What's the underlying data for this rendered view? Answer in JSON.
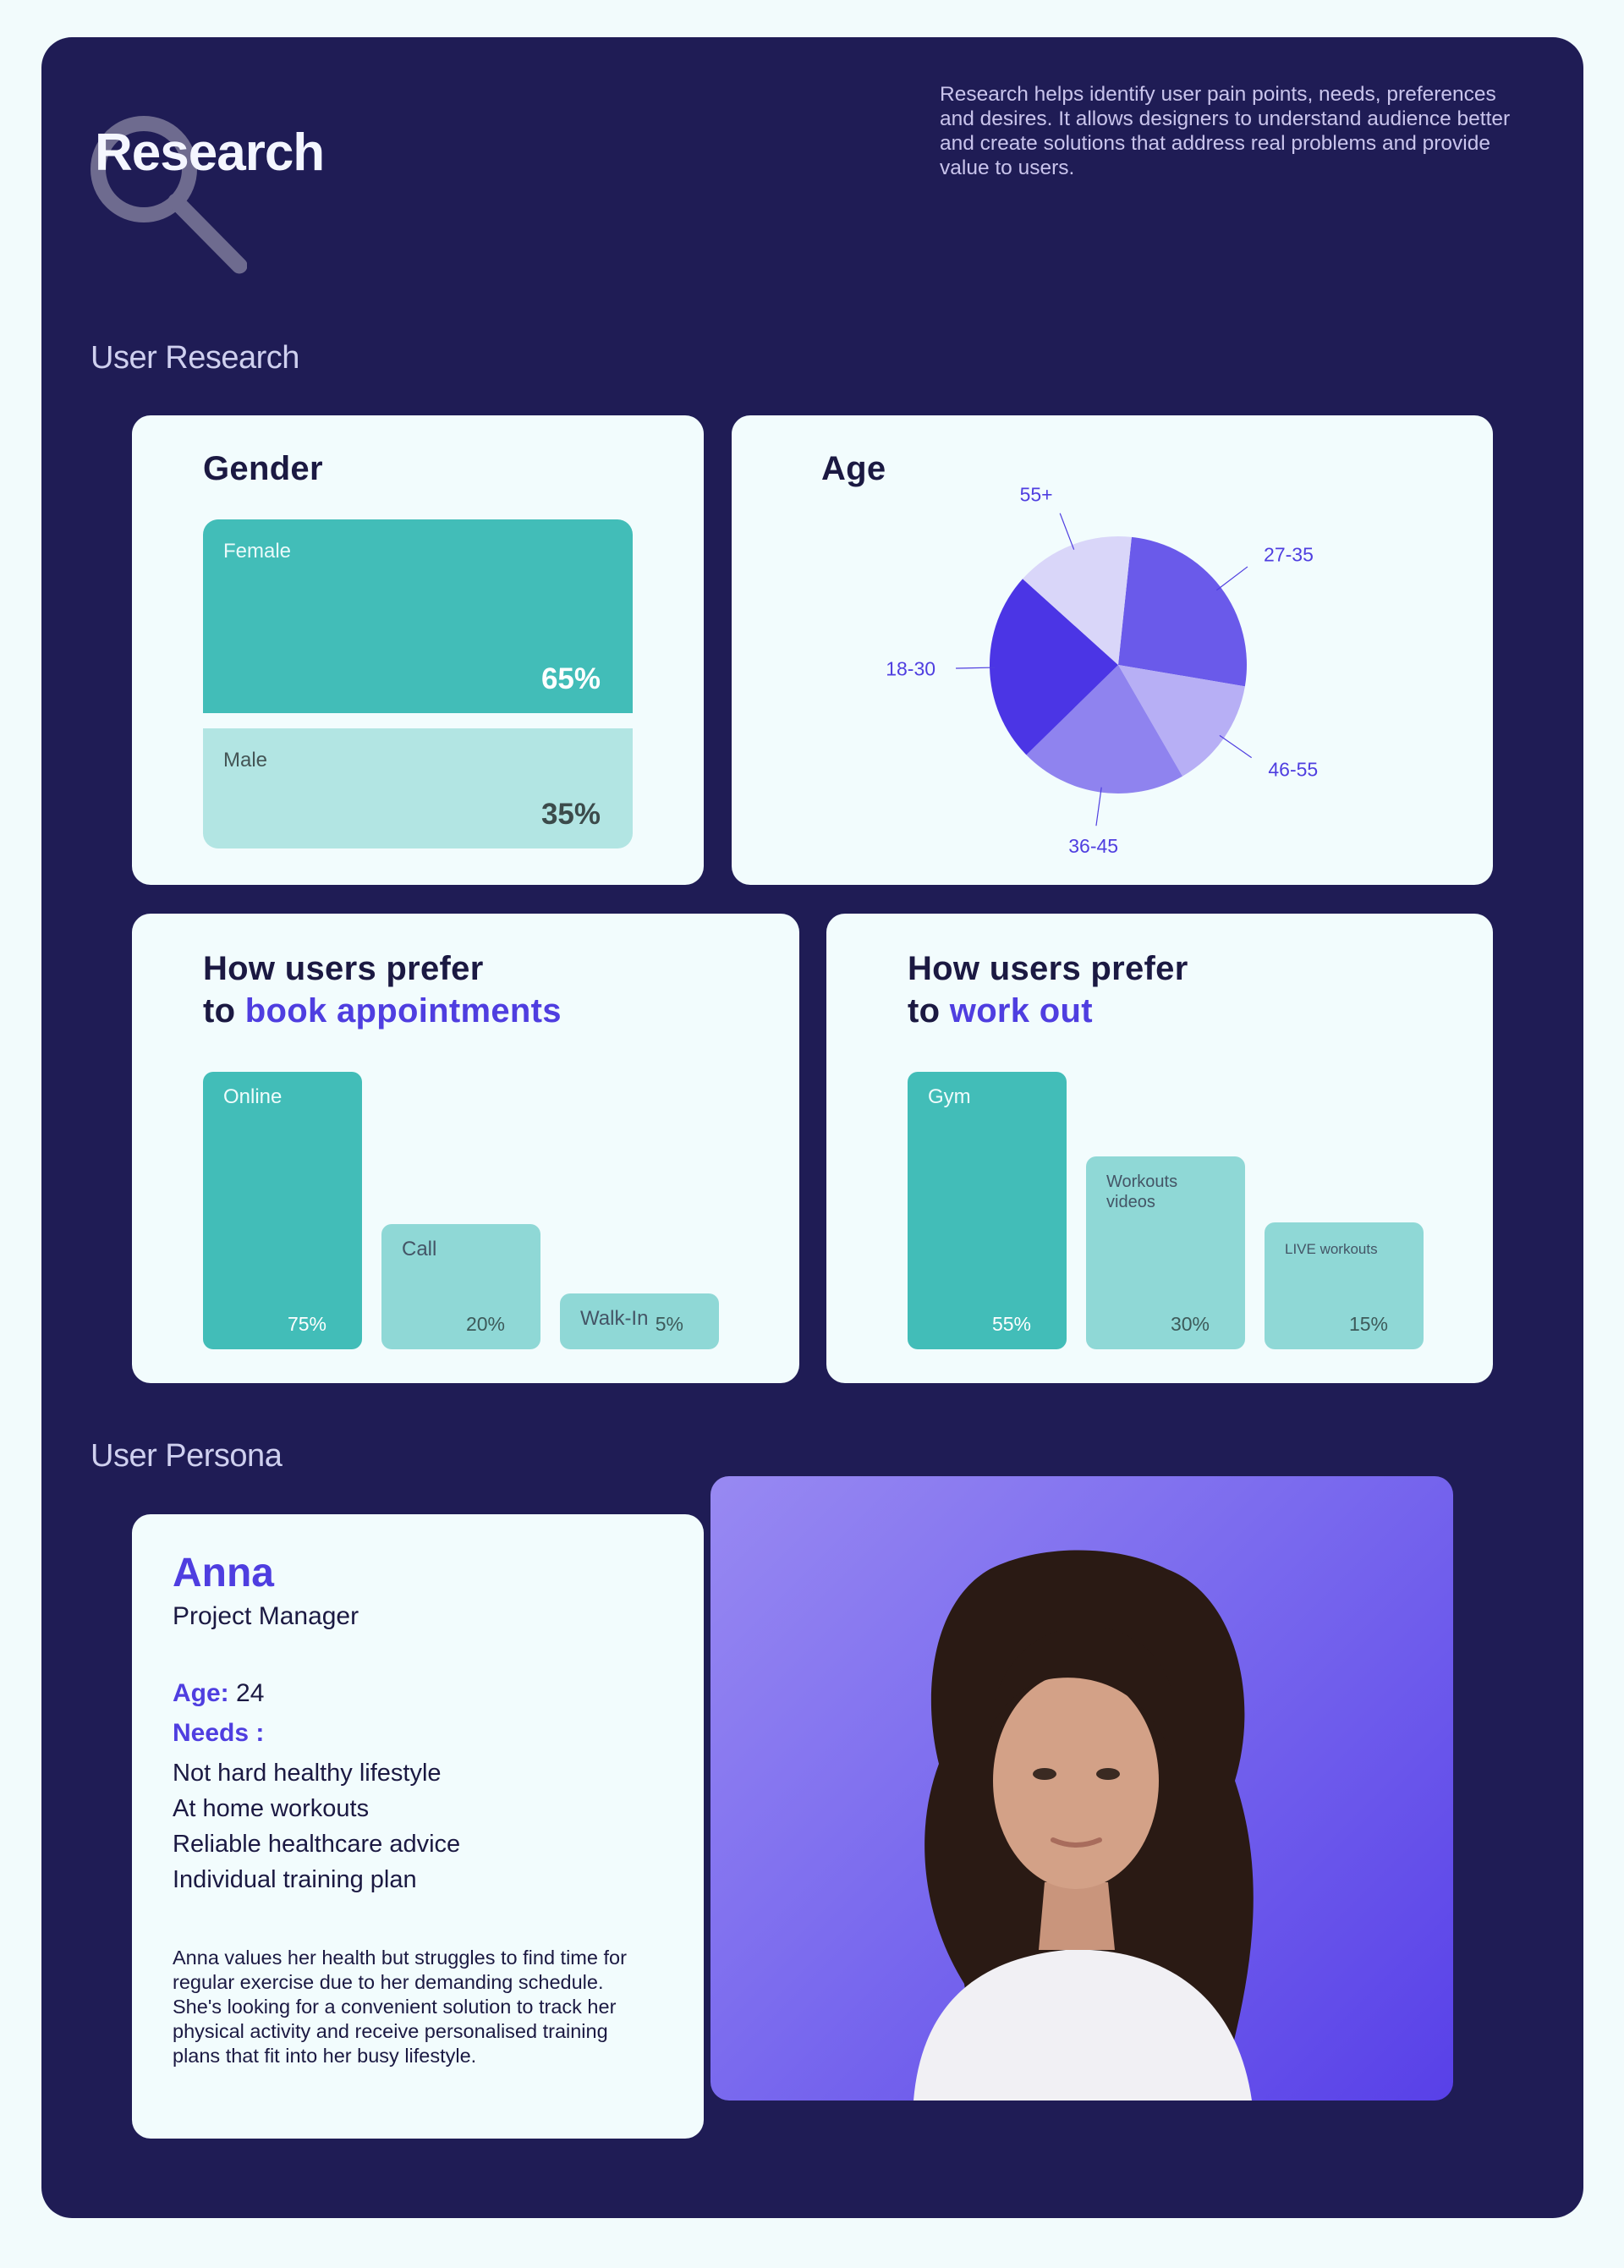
{
  "header": {
    "title": "Research",
    "description": "Research helps identify user pain points, needs, preferences and desires. It allows designers to understand audience better and create solutions that address real problems and provide value to users."
  },
  "sections": {
    "user_research": "User Research",
    "user_persona": "User Persona"
  },
  "colors": {
    "background": "#1f1c55",
    "teal": "#42bdb8",
    "teal_light": "#8fd8d6",
    "violet": "#4f3ee0"
  },
  "gender": {
    "title": "Gender"
  },
  "age": {
    "title": "Age"
  },
  "appointments": {
    "title_line1": "How users prefer",
    "title_prefix": "to ",
    "title_accent": "book appointments"
  },
  "workout": {
    "title_line1": "How users prefer",
    "title_prefix": "to ",
    "title_accent": "work out"
  },
  "chart_data": [
    {
      "type": "bar",
      "title": "Gender",
      "categories": [
        "Female",
        "Male"
      ],
      "values": [
        65,
        35
      ],
      "value_labels": [
        "65%",
        "35%"
      ],
      "orientation": "stacked-horizontal"
    },
    {
      "type": "pie",
      "title": "Age",
      "categories": [
        "27-35",
        "46-55",
        "36-45",
        "18-30",
        "55+"
      ],
      "values": [
        26,
        14,
        21,
        24,
        15
      ],
      "colors": [
        "#6a5aea",
        "#b7aff5",
        "#8f83ef",
        "#4b35e5",
        "#d9d6f9"
      ]
    },
    {
      "type": "bar",
      "title": "How users prefer to book appointments",
      "categories": [
        "Online",
        "Call",
        "Walk-In"
      ],
      "values": [
        75,
        20,
        5
      ],
      "value_labels": [
        "75%",
        "20%",
        "5%"
      ]
    },
    {
      "type": "bar",
      "title": "How users prefer to work out",
      "categories": [
        "Gym",
        "Workouts videos",
        "LIVE workouts"
      ],
      "values": [
        55,
        30,
        15
      ],
      "value_labels": [
        "55%",
        "30%",
        "15%"
      ]
    }
  ],
  "persona": {
    "name": "Anna",
    "role": "Project Manager",
    "age_label": "Age:",
    "age_value": "24",
    "needs_label": "Needs :",
    "needs": [
      "Not hard healthy lifestyle",
      "At home workouts",
      "Reliable healthcare advice",
      "Individual training plan"
    ],
    "bio": "Anna values her health but struggles to find time for regular exercise due to her demanding schedule. She's looking for a convenient solution to track her physical activity and receive personalised training plans that fit into her busy lifestyle."
  }
}
